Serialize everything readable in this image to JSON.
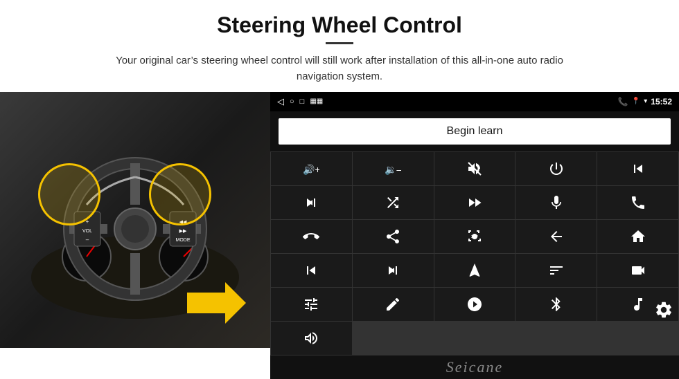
{
  "header": {
    "title": "Steering Wheel Control",
    "subtitle": "Your original car’s steering wheel control will still work after installation of this all-in-one auto radio navigation system."
  },
  "statusbar": {
    "time": "15:52",
    "icons": [
      "back-arrow",
      "home-circle",
      "square-window",
      "signal-bars"
    ]
  },
  "begin_learn": {
    "label": "Begin learn"
  },
  "controls": [
    {
      "icon": "volume-up-plus",
      "unicode": "🔊+"
    },
    {
      "icon": "volume-down-minus",
      "unicode": "🔉-"
    },
    {
      "icon": "mute",
      "unicode": "🔇"
    },
    {
      "icon": "power",
      "unicode": "⏻"
    },
    {
      "icon": "prev-track",
      "unicode": "⏮"
    },
    {
      "icon": "next-track-skip",
      "unicode": "⏭"
    },
    {
      "icon": "shuffle",
      "unicode": "⇌"
    },
    {
      "icon": "fast-forward",
      "unicode": "⏩"
    },
    {
      "icon": "microphone",
      "unicode": "🎤"
    },
    {
      "icon": "phone",
      "unicode": "📞"
    },
    {
      "icon": "hang-up",
      "unicode": "📵"
    },
    {
      "icon": "speaker-car",
      "unicode": "📢"
    },
    {
      "icon": "360-view",
      "unicode": "🔭"
    },
    {
      "icon": "back-arrow",
      "unicode": "↩"
    },
    {
      "icon": "home",
      "unicode": "⌂"
    },
    {
      "icon": "skip-back",
      "unicode": "⏮"
    },
    {
      "icon": "fast-forward-double",
      "unicode": "⏭"
    },
    {
      "icon": "navigation",
      "unicode": "➤"
    },
    {
      "icon": "equalizer",
      "unicode": "⇌"
    },
    {
      "icon": "camera-record",
      "unicode": "📷"
    },
    {
      "icon": "settings-sliders",
      "unicode": "🎚"
    },
    {
      "icon": "pen-edit",
      "unicode": "✏"
    },
    {
      "icon": "target-circle",
      "unicode": "🎯"
    },
    {
      "icon": "bluetooth",
      "unicode": "Ⓑ"
    },
    {
      "icon": "music-note-settings",
      "unicode": "🎵"
    },
    {
      "icon": "waveform",
      "unicode": "📊"
    }
  ],
  "brand": {
    "name": "Seicane"
  }
}
